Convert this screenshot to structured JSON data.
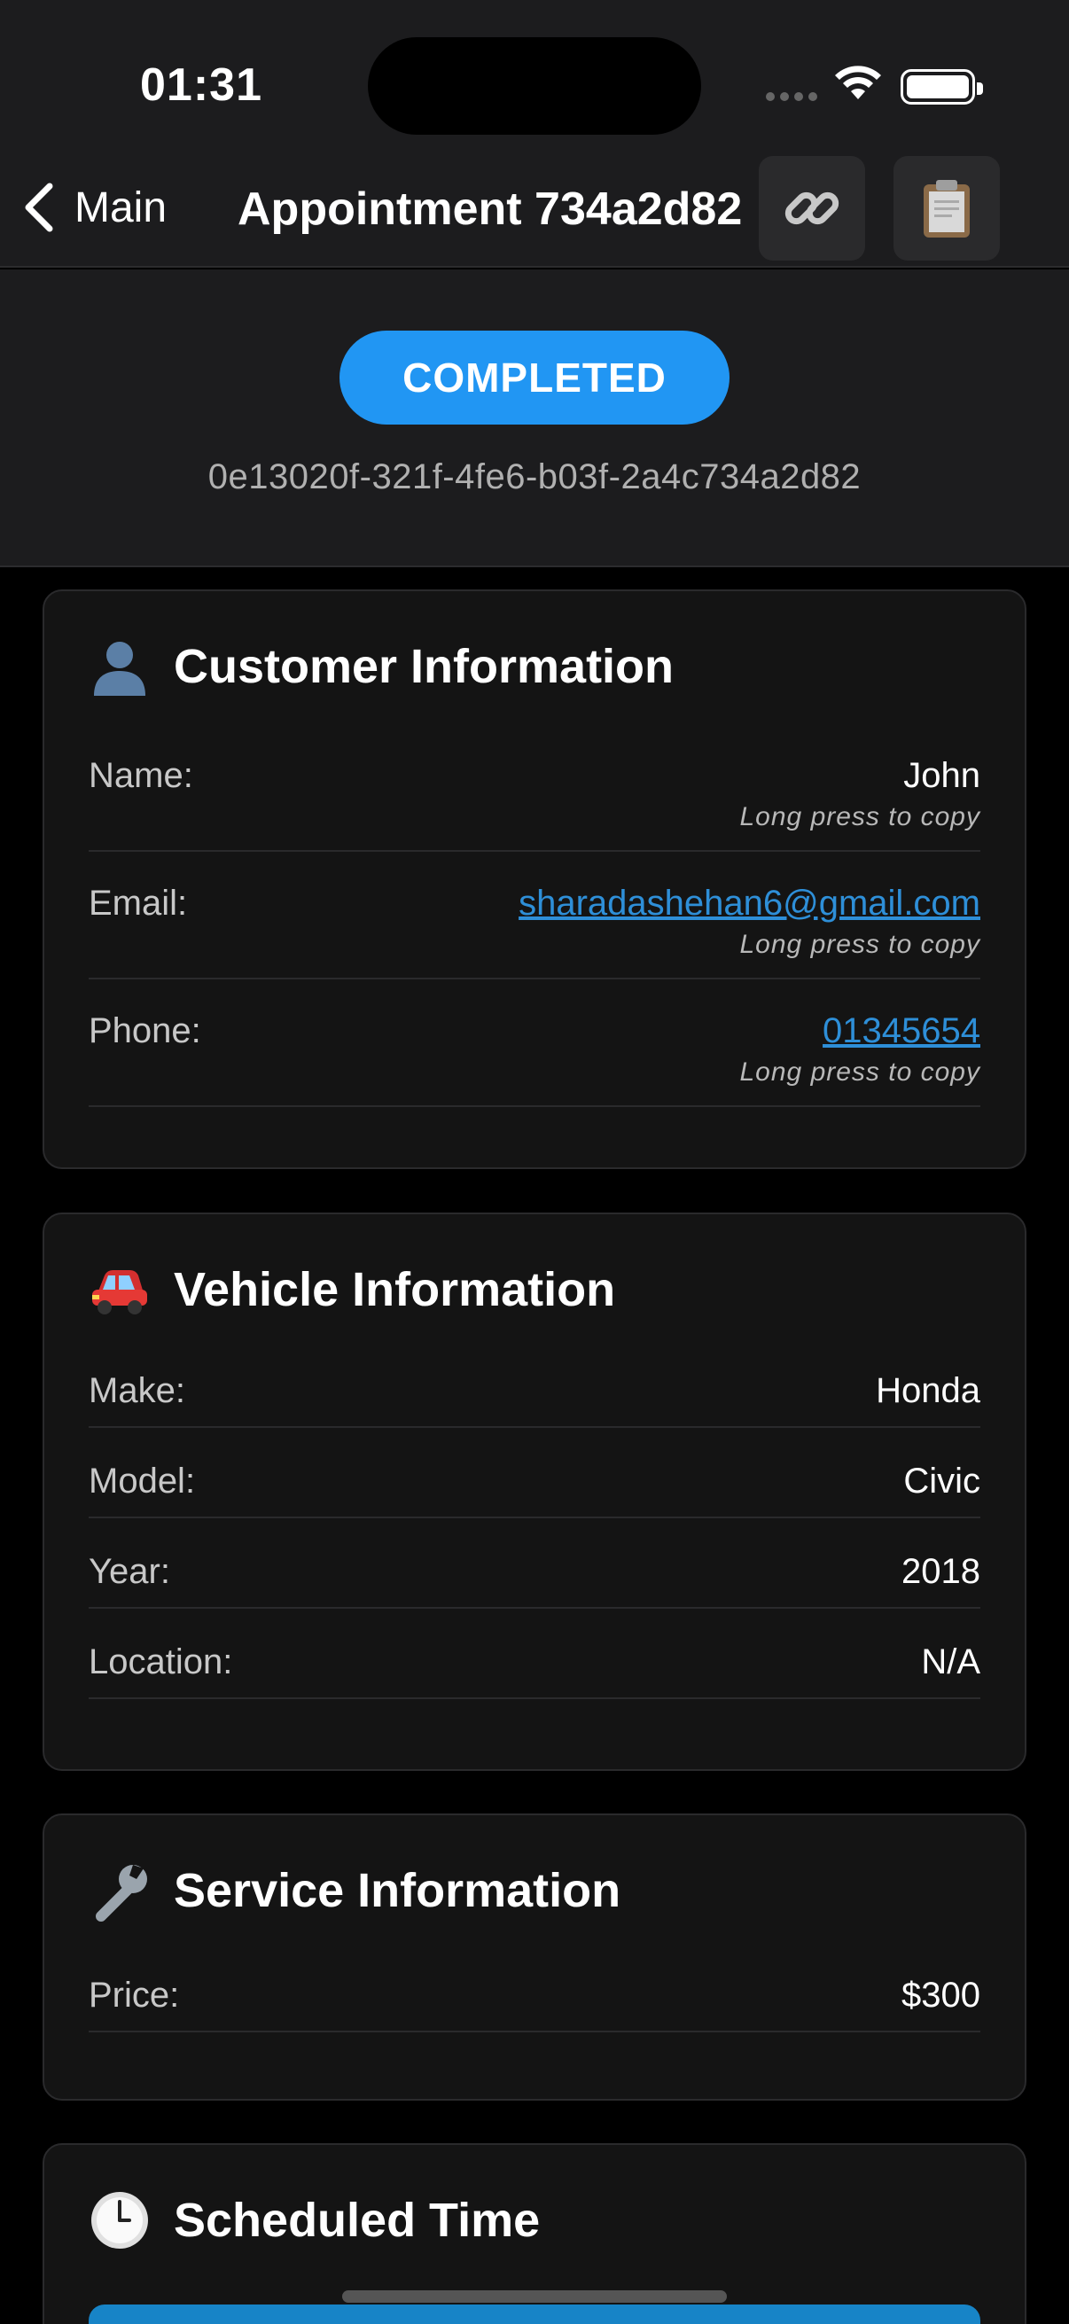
{
  "status_bar": {
    "time": "01:31"
  },
  "nav": {
    "back_label": "Main",
    "title": "Appointment 734a2d82",
    "actions": [
      {
        "icon": "link-icon"
      },
      {
        "icon": "clipboard-icon"
      }
    ]
  },
  "appointment": {
    "status": "COMPLETED",
    "status_color": "#2196f3",
    "id": "0e13020f-321f-4fe6-b03f-2a4c734a2d82"
  },
  "customer": {
    "title": "Customer Information",
    "icon": "person-icon",
    "hint": "Long press to copy",
    "rows": [
      {
        "label": "Name:",
        "value": "John"
      },
      {
        "label": "Email:",
        "value": "sharadashehan6@gmail.com"
      },
      {
        "label": "Phone:",
        "value": "01345654"
      }
    ]
  },
  "vehicle": {
    "title": "Vehicle Information",
    "icon": "car-icon",
    "rows": [
      {
        "label": "Make:",
        "value": "Honda"
      },
      {
        "label": "Model:",
        "value": "Civic"
      },
      {
        "label": "Year:",
        "value": "2018"
      },
      {
        "label": "Location:",
        "value": "N/A"
      }
    ]
  },
  "service": {
    "title": "Service Information",
    "icon": "wrench-icon",
    "rows": [
      {
        "label": "Price:",
        "value": "$300"
      }
    ]
  },
  "schedule": {
    "title": "Scheduled Time",
    "icon": "clock-icon"
  },
  "colors": {
    "accent": "#2196f3",
    "link": "#2e8fd8",
    "card": "#141414",
    "background": "#000000"
  }
}
